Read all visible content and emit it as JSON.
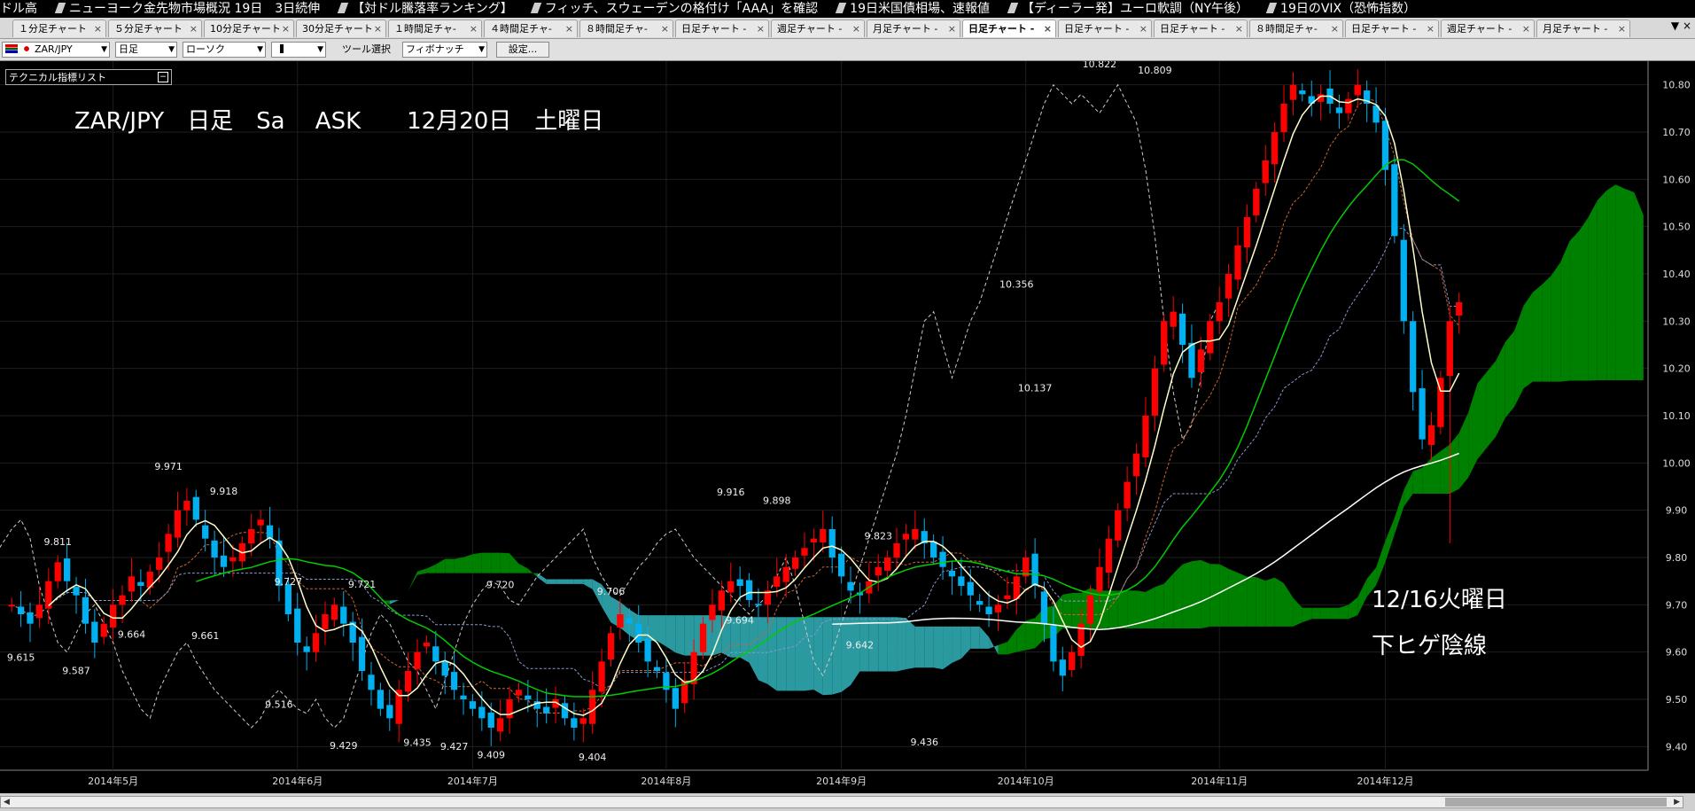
{
  "ticker": [
    "ドル高",
    "ニューヨーク金先物市場概況 19日　3日続伸",
    "【対ドル騰落率ランキング】",
    "フィッチ、スウェーデンの格付け「AAA」を確認",
    "19日米国債相場、速報値",
    "【ディーラー発】ユーロ軟調（NY午後）",
    "19日のVIX（恐怖指数）"
  ],
  "tabs": [
    {
      "label": "１分足チャート"
    },
    {
      "label": "５分足チャート"
    },
    {
      "label": "10分足チャート"
    },
    {
      "label": "30分足チャート"
    },
    {
      "label": "１時間足チャ-"
    },
    {
      "label": "４時間足チャ-"
    },
    {
      "label": "８時間足チャ-"
    },
    {
      "label": "日足チャート -"
    },
    {
      "label": "週足チャート -"
    },
    {
      "label": "月足チャート -"
    },
    {
      "label": "日足チャート -"
    },
    {
      "label": "日足チャート -"
    },
    {
      "label": "日足チャート -"
    },
    {
      "label": "８時間足チャ-"
    },
    {
      "label": "日足チャート -"
    },
    {
      "label": "週足チャート -"
    },
    {
      "label": "月足チャート -"
    }
  ],
  "active_tab": 10,
  "close_glyph": "×",
  "toolbar": {
    "pair": "ZAR/JPY",
    "timeframe": "日足",
    "chart_type": "ローソク",
    "tool_label": "ツール選択",
    "tool_value": "フィボナッチ",
    "settings_label": "設定..."
  },
  "indicator_panel": {
    "label": "テクニカル指標リスト"
  },
  "chart_title": "ZAR/JPY　日足　Sa　 ASK　　12月20日　土曜日",
  "annotations": {
    "line1": "12/16火曜日",
    "line2": "下ヒゲ陰線"
  },
  "chart_data": {
    "type": "candlestick",
    "instrument": "ZAR/JPY",
    "timeframe": "日足",
    "ylim": [
      9.35,
      10.85
    ],
    "y_ticks": [
      9.4,
      9.5,
      9.6,
      9.7,
      9.8,
      9.9,
      10.0,
      10.1,
      10.2,
      10.3,
      10.4,
      10.5,
      10.6,
      10.7,
      10.8
    ],
    "x_labels": [
      {
        "label": "2014年5月",
        "index": 11
      },
      {
        "label": "2014年6月",
        "index": 31
      },
      {
        "label": "2014年7月",
        "index": 50
      },
      {
        "label": "2014年8月",
        "index": 71
      },
      {
        "label": "2014年9月",
        "index": 90
      },
      {
        "label": "2014年10月",
        "index": 110
      },
      {
        "label": "2014年11月",
        "index": 131
      },
      {
        "label": "2014年12月",
        "index": 149
      }
    ],
    "close": [
      9.7,
      9.68,
      9.66,
      9.7,
      9.75,
      9.79,
      9.75,
      9.72,
      9.66,
      9.62,
      9.66,
      9.7,
      9.72,
      9.76,
      9.74,
      9.77,
      9.8,
      9.85,
      9.9,
      9.92,
      9.88,
      9.84,
      9.8,
      9.78,
      9.8,
      9.83,
      9.86,
      9.88,
      9.84,
      9.74,
      9.68,
      9.62,
      9.6,
      9.64,
      9.68,
      9.7,
      9.66,
      9.62,
      9.56,
      9.52,
      9.48,
      9.46,
      9.52,
      9.56,
      9.6,
      9.62,
      9.58,
      9.55,
      9.52,
      9.5,
      9.48,
      9.46,
      9.44,
      9.46,
      9.5,
      9.52,
      9.5,
      9.48,
      9.47,
      9.5,
      9.46,
      9.44,
      9.46,
      9.52,
      9.58,
      9.64,
      9.68,
      9.66,
      9.62,
      9.58,
      9.56,
      9.52,
      9.48,
      9.54,
      9.6,
      9.66,
      9.7,
      9.73,
      9.75,
      9.74,
      9.71,
      9.7,
      9.73,
      9.76,
      9.78,
      9.8,
      9.82,
      9.84,
      9.86,
      9.8,
      9.76,
      9.73,
      9.72,
      9.75,
      9.78,
      9.8,
      9.83,
      9.85,
      9.86,
      9.83,
      9.8,
      9.78,
      9.76,
      9.74,
      9.72,
      9.7,
      9.68,
      9.7,
      9.72,
      9.76,
      9.8,
      9.74,
      9.66,
      9.58,
      9.55,
      9.6,
      9.66,
      9.72,
      9.78,
      9.84,
      9.9,
      9.96,
      10.02,
      10.1,
      10.2,
      10.3,
      10.32,
      10.25,
      10.18,
      10.24,
      10.3,
      10.34,
      10.4,
      10.46,
      10.52,
      10.58,
      10.64,
      10.7,
      10.76,
      10.8,
      10.78,
      10.76,
      10.78,
      10.76,
      10.74,
      10.77,
      10.8,
      10.76,
      10.72,
      10.62,
      10.48,
      10.3,
      10.15,
      10.05,
      10.08,
      10.18,
      10.3,
      10.34
    ],
    "labels": [
      {
        "text": "9.971",
        "x_index": 17,
        "value": 9.971
      },
      {
        "text": "9.918",
        "x_index": 23,
        "value": 9.918
      },
      {
        "text": "9.811",
        "x_index": 5,
        "value": 9.811
      },
      {
        "text": "9.727",
        "x_index": 30,
        "value": 9.727
      },
      {
        "text": "9.721",
        "x_index": 38,
        "value": 9.721
      },
      {
        "text": "9.720",
        "x_index": 53,
        "value": 9.72
      },
      {
        "text": "9.706",
        "x_index": 65,
        "value": 9.706
      },
      {
        "text": "9.916",
        "x_index": 78,
        "value": 9.916
      },
      {
        "text": "9.898",
        "x_index": 83,
        "value": 9.898
      },
      {
        "text": "9.823",
        "x_index": 94,
        "value": 9.823
      },
      {
        "text": "9.694",
        "x_index": 79,
        "value": 9.694
      },
      {
        "text": "9.642",
        "x_index": 92,
        "value": 9.642
      },
      {
        "text": "9.664",
        "x_index": 13,
        "value": 9.664
      },
      {
        "text": "9.661",
        "x_index": 21,
        "value": 9.661
      },
      {
        "text": "9.615",
        "x_index": 1,
        "value": 9.615
      },
      {
        "text": "9.587",
        "x_index": 7,
        "value": 9.587
      },
      {
        "text": "9.516",
        "x_index": 29,
        "value": 9.516
      },
      {
        "text": "9.429",
        "x_index": 36,
        "value": 9.429
      },
      {
        "text": "9.435",
        "x_index": 44,
        "value": 9.435
      },
      {
        "text": "9.427",
        "x_index": 48,
        "value": 9.427
      },
      {
        "text": "9.409",
        "x_index": 52,
        "value": 9.409
      },
      {
        "text": "9.404",
        "x_index": 63,
        "value": 9.404
      },
      {
        "text": "9.436",
        "x_index": 99,
        "value": 9.436
      },
      {
        "text": "10.356",
        "x_index": 109,
        "value": 10.356
      },
      {
        "text": "10.137",
        "x_index": 111,
        "value": 10.137
      },
      {
        "text": "10.822",
        "x_index": 118,
        "value": 10.822
      },
      {
        "text": "10.809",
        "x_index": 124,
        "value": 10.809
      }
    ],
    "series": [
      {
        "color": "#ffffcc"
      },
      {
        "color": "#00cc00"
      },
      {
        "color": "#ffffff"
      },
      {
        "color": "#cccccc"
      },
      {
        "color": "#8899cc"
      },
      {
        "color": "#cc6633"
      }
    ],
    "candle_up_color": "#ff0000",
    "candle_down_color": "#00b0f0",
    "cloud_bull_color": "#008000",
    "cloud_bear_color": "#2a9aa0"
  }
}
